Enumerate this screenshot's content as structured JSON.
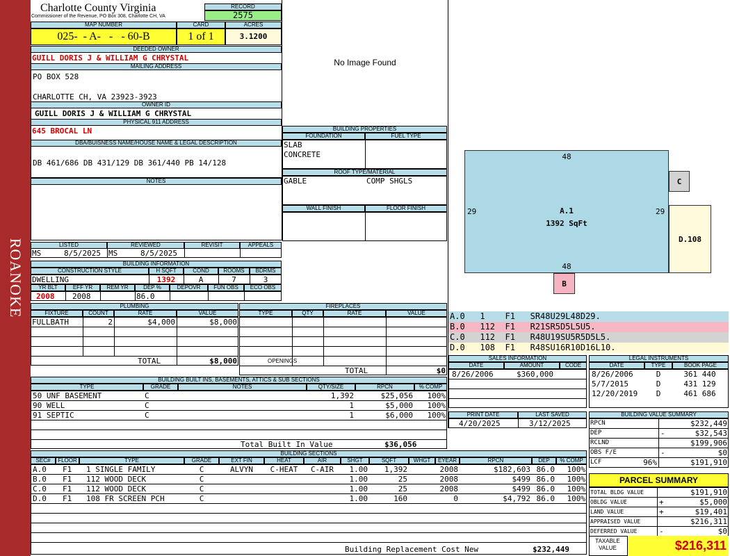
{
  "sidebar": {
    "label": "ROANOKE"
  },
  "header": {
    "county": "Charlotte County Virginia",
    "commissioner": "Commissioner of the Revenue, PO Box 308, Charlotte CH, VA",
    "record_label": "RECORD",
    "record": "2575",
    "map_label": "MAP NUMBER",
    "map_number": "025-  - A-   -   - 60-B",
    "card_label": "CARD",
    "card": "1 of 1",
    "acres_label": "ACRES",
    "acres": "3.1200"
  },
  "owner": {
    "deeded_label": "DEEDED OWNER",
    "deeded": "GUILL DORIS J & WILLIAM G CHRYSTAL",
    "mailing_label": "MAILING ADDRESS",
    "mail1": "PO BOX 528",
    "mail2": "CHARLOTTE CH, VA 23923-3923",
    "id_label": "OWNER ID",
    "owner_id": "GUILL DORIS J & WILLIAM G CHRYSTAL",
    "phys_label": "PHYSICAL 911 ADDRESS",
    "physical": "645 BROCAL LN",
    "dba_label": "DBA/BUISNESS NAME/HOUSE NAME & LEGAL DESCRIPTION",
    "legal": "DB 461/686 DB 431/129 DB 361/440 PB 14/128",
    "notes_label": "NOTES"
  },
  "photo": {
    "text": "No Image Found"
  },
  "listing": {
    "listed_label": "LISTED",
    "reviewed_label": "REVIEWED",
    "revisit_label": "REVISIT",
    "appeals_label": "APPEALS",
    "listed_by": "MS",
    "listed_date": "8/5/2025",
    "reviewed_by": "MS",
    "reviewed_date": "8/5/2025"
  },
  "building_info": {
    "title": "BUILDING INFORMATION",
    "style_label": "CONSTRUCTION STYLE",
    "hsqft_label": "H SQFT",
    "cond_label": "COND",
    "rooms_label": "ROOMS",
    "bdrms_label": "BDRMS",
    "style": "DWELLING",
    "hsqft": "1392",
    "cond": "A",
    "rooms": "7",
    "bdrms": "3",
    "yrblt_label": "YR BLT",
    "effyr_label": "EFF YR",
    "remyr_label": "REM YR",
    "dep_label": "DEP %",
    "depovr_label": "DEPOVR",
    "funobs_label": "FUN OBS",
    "ecoobs_label": "ECO OBS",
    "yrblt": "2008",
    "effyr": "2008",
    "remyr": "",
    "dep": "86.0"
  },
  "props": {
    "title": "BUILDING PROPERTIES",
    "foundation_label": "FOUNDATION",
    "fuel_label": "FUEL TYPE",
    "found1": "SLAB",
    "found2": "CONCRETE",
    "roof_label": "ROOF TYPE/MATERIAL",
    "roof_type": "GABLE",
    "roof_mat": "COMP SHGLS",
    "wall_label": "WALL FINISH",
    "floor_label": "FLOOR FINISH"
  },
  "plumbing": {
    "title": "PLUMBING",
    "h_fixture": "FIXTURE",
    "h_count": "COUNT",
    "h_rate": "RATE",
    "h_value": "VALUE",
    "rows": [
      {
        "fixture": "FULLBATH",
        "count": "2",
        "rate": "$4,000",
        "value": "$8,000"
      }
    ],
    "total_label": "TOTAL",
    "total": "$8,000"
  },
  "fireplaces": {
    "title": "FIREPLACES",
    "h_type": "TYPE",
    "h_qty": "QTY",
    "h_rate": "RATE",
    "h_value": "VALUE",
    "openings_label": "OPENINGS",
    "total_label": "TOTAL",
    "total": "$0"
  },
  "builtins": {
    "title": "BUILDING BUILT INS, BASEMENTS, ATTICS & SUB SECTIONS",
    "h_type": "TYPE",
    "h_grade": "GRADE",
    "h_notes": "NOTES",
    "h_qty": "QTY/SIZE",
    "h_rpcn": "RPCN",
    "h_comp": "% COMP",
    "rows": [
      {
        "type": "50 UNF BASEMENT",
        "grade": "C",
        "notes": "",
        "qty": "1,392",
        "rpcn": "$25,056",
        "comp": "100%"
      },
      {
        "type": "90 WELL",
        "grade": "C",
        "notes": "",
        "qty": "1",
        "rpcn": "$5,000",
        "comp": "100%"
      },
      {
        "type": "91 SEPTIC",
        "grade": "C",
        "notes": "",
        "qty": "1",
        "rpcn": "$6,000",
        "comp": "100%"
      }
    ],
    "total_label": "Total Built In Value",
    "total": "$36,056"
  },
  "sections": {
    "title": "BUILDING SECTIONS",
    "headers": [
      "SEC#",
      "FLOOR",
      "TYPE",
      "GRADE",
      "EXT FIN",
      "HEAT",
      "AIR",
      "SHGT",
      "SQFT",
      "WHGT",
      "EYEAR",
      "RPCN",
      "DEP",
      "% COMP"
    ],
    "rows": [
      {
        "sec": "A.0",
        "floor": "F1",
        "type": "1 SINGLE FAMILY",
        "grade": "C",
        "ext": "ALVYN",
        "heat": "C-HEAT",
        "air": "C-AIR",
        "shgt": "1.00",
        "sqft": "1,392",
        "whgt": "",
        "eyear": "2008",
        "rpcn": "$182,603",
        "dep": "86.0",
        "comp": "100%"
      },
      {
        "sec": "B.0",
        "floor": "F1",
        "type": "112 WOOD DECK",
        "grade": "C",
        "ext": "",
        "heat": "",
        "air": "",
        "shgt": "1.00",
        "sqft": "25",
        "whgt": "",
        "eyear": "2008",
        "rpcn": "$499",
        "dep": "86.0",
        "comp": "100%"
      },
      {
        "sec": "C.0",
        "floor": "F1",
        "type": "112 WOOD DECK",
        "grade": "C",
        "ext": "",
        "heat": "",
        "air": "",
        "shgt": "1.00",
        "sqft": "25",
        "whgt": "",
        "eyear": "2008",
        "rpcn": "$499",
        "dep": "86.0",
        "comp": "100%"
      },
      {
        "sec": "D.0",
        "floor": "F1",
        "type": "108 FR SCREEN PCH",
        "grade": "C",
        "ext": "",
        "heat": "",
        "air": "",
        "shgt": "1.00",
        "sqft": "160",
        "whgt": "",
        "eyear": "0",
        "rpcn": "$4,792",
        "dep": "86.0",
        "comp": "100%"
      }
    ],
    "brcn_label": "Building Replacement Cost New",
    "brcn": "$232,449"
  },
  "sketch": {
    "main_label": "A.1",
    "main_area": "1392 SqFt",
    "top": "48",
    "bottom": "48",
    "left": "29",
    "right": "29",
    "c": "C",
    "d": "D.108",
    "b": "B"
  },
  "vectors": [
    {
      "text": "A.0   1    F1   SR48U29L48D29.",
      "color": "#b7dde8"
    },
    {
      "text": "B.0   112  F1   R21SR5D5L5U5.",
      "color": "#f5b8c4"
    },
    {
      "text": "C.0   112  F1   R48U19SU5R5D5L5.",
      "color": "#d3d3d3"
    },
    {
      "text": "D.0   108  F1   R48SU16R10D16L10.",
      "color": "#fff9d6"
    }
  ],
  "sales": {
    "title": "SALES INFORMATION",
    "h_date": "DATE",
    "h_amount": "AMOUNT",
    "h_code": "CODE",
    "rows": [
      {
        "date": "8/26/2006",
        "amount": "$360,000",
        "code": ""
      }
    ]
  },
  "legal": {
    "title": "LEGAL INSTRUMENTS",
    "h_date": "DATE",
    "h_type": "TYPE",
    "h_book": "BOOK PAGE",
    "rows": [
      {
        "date": "8/26/2006",
        "type": "D",
        "book": "361 440"
      },
      {
        "date": "5/7/2015",
        "type": "D",
        "book": "431 129"
      },
      {
        "date": "12/20/2019",
        "type": "D",
        "book": "461 686"
      }
    ]
  },
  "print": {
    "print_label": "PRINT DATE",
    "saved_label": "LAST SAVED",
    "print_date": "4/20/2025",
    "saved_date": "3/12/2025"
  },
  "bvs": {
    "title": "BUILDING VALUE SUMMARY",
    "rows": [
      {
        "label": "RPCN",
        "sign": "",
        "value": "$232,449"
      },
      {
        "label": "DEP",
        "sign": "-",
        "value": "$32,543"
      },
      {
        "label": "RCLND",
        "sign": "",
        "value": "$199,906"
      },
      {
        "label": "OBS F/E",
        "sign": "-",
        "value": "$0"
      },
      {
        "label": "LCF",
        "pct": "96%",
        "sign": "",
        "value": "$191,910"
      }
    ]
  },
  "parcel": {
    "title": "PARCEL SUMMARY",
    "rows": [
      {
        "label": "TOTAL BLDG VALUE",
        "sign": "",
        "value": "$191,910"
      },
      {
        "label": "OBLDG VALUE",
        "sign": "+",
        "value": "$5,000"
      },
      {
        "label": "LAND VALUE",
        "sign": "+",
        "value": "$19,401"
      },
      {
        "label": "APPRAISED VALUE",
        "sign": "",
        "value": "$216,311"
      },
      {
        "label": "DEFERRED VALUE",
        "sign": "-",
        "value": "$0"
      }
    ],
    "taxable_label1": "TAXABLE",
    "taxable_label2": "VALUE",
    "taxable": "$216,311"
  },
  "colors": {
    "sidebar": "#a82a2a",
    "header": "#b7dde8",
    "yellow": "#ffff33",
    "green": "#99ee88",
    "main_section": "#add8e6",
    "c_section": "#d3d3d3",
    "d_section": "#fffadc",
    "b_section": "#f6b3c1"
  }
}
